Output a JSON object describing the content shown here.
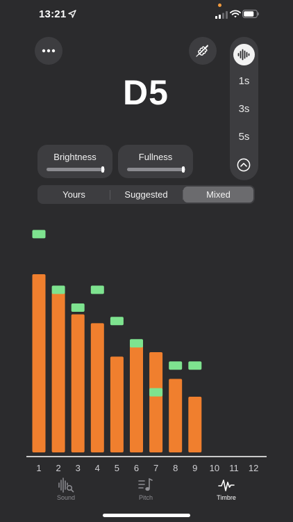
{
  "status_bar": {
    "time": "13:21",
    "location_icon": "location-arrow-icon",
    "signal_icon": "cellular-signal-icon",
    "wifi_icon": "wifi-icon",
    "battery_icon": "battery-icon",
    "battery_level": 0.8
  },
  "header": {
    "more_icon": "ellipsis-icon",
    "instrument_icon": "violin-icon",
    "note": "D5"
  },
  "side_panel": {
    "waveform_icon": "waveform-icon",
    "durations": [
      "1s",
      "3s",
      "5s"
    ],
    "collapse_icon": "chevron-up-circle-icon"
  },
  "sliders": {
    "brightness": {
      "label": "Brightness",
      "value": 1.0
    },
    "fullness": {
      "label": "Fullness",
      "value": 1.0
    }
  },
  "segmented": {
    "options": [
      "Yours",
      "Suggested",
      "Mixed"
    ],
    "selected": "Mixed"
  },
  "colors": {
    "background": "#2b2b2d",
    "panel": "#3d3d40",
    "bar": "#f07f2e",
    "marker": "#7ee38f",
    "axis": "#ffffff"
  },
  "chart_data": {
    "type": "bar",
    "categories": [
      "1",
      "2",
      "3",
      "4",
      "5",
      "6",
      "7",
      "8",
      "9",
      "10",
      "11",
      "12"
    ],
    "ylim": [
      0,
      1
    ],
    "grid": false,
    "series": [
      {
        "values": [
          0.8,
          0.72,
          0.62,
          0.58,
          0.43,
          0.48,
          0.45,
          0.33,
          0.25,
          null,
          null,
          null
        ]
      },
      {
        "values": [
          0.98,
          0.73,
          0.65,
          0.73,
          0.59,
          0.49,
          0.27,
          0.39,
          0.39,
          null,
          null,
          null
        ]
      }
    ]
  },
  "tab_bar": {
    "tabs": [
      {
        "label": "Sound",
        "icon": "waveform-magnifier-icon"
      },
      {
        "label": "Pitch",
        "icon": "music-note-list-icon"
      },
      {
        "label": "Timbre",
        "icon": "waveform-path-icon"
      }
    ],
    "active": "Timbre"
  }
}
